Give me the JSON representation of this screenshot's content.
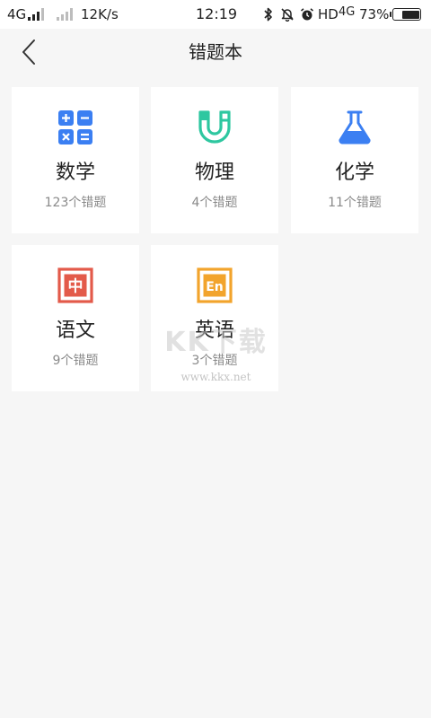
{
  "status_bar": {
    "network_type": "4G",
    "speed": "12K/s",
    "time": "12:19",
    "hd_label": "HD",
    "network_type_2": "4G",
    "battery_percent": "73%",
    "battery_level": 0.73,
    "icons": [
      "signal-icon",
      "bluetooth-icon",
      "mute-icon",
      "alarm-icon",
      "battery-icon"
    ]
  },
  "header": {
    "title": "错题本",
    "back_icon": "chevron-left-icon"
  },
  "subjects": [
    {
      "name": "数学",
      "count": "123个错题",
      "icon": "calculator-icon",
      "color": "#3b7ff2"
    },
    {
      "name": "物理",
      "count": "4个错题",
      "icon": "magnet-icon",
      "color": "#2ec7a0"
    },
    {
      "name": "化学",
      "count": "11个错题",
      "icon": "flask-icon",
      "color": "#3b7ff2"
    },
    {
      "name": "语文",
      "count": "9个错题",
      "icon": "chinese-char-icon",
      "color": "#e35a4a",
      "glyph": "中"
    },
    {
      "name": "英语",
      "count": "3个错题",
      "icon": "english-letter-icon",
      "color": "#f2a42c",
      "glyph": "En"
    }
  ],
  "watermark": {
    "text": "KK下载",
    "url": "www.kkx.net"
  }
}
